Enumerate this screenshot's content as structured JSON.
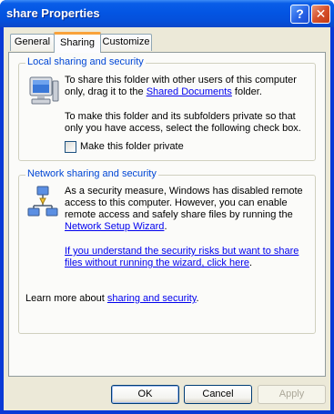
{
  "window": {
    "title": "share Properties",
    "help_glyph": "?",
    "close_glyph": "✕",
    "icons": {
      "help": "help-icon",
      "close": "close-icon"
    }
  },
  "tabs": [
    {
      "label": "General",
      "selected": false
    },
    {
      "label": "Sharing",
      "selected": true
    },
    {
      "label": "Customize",
      "selected": false
    }
  ],
  "local": {
    "legend": "Local sharing and security",
    "icon": "computer-icon",
    "para1_line1": "To share this folder with other users of this computer",
    "para1_line2_pre": "only, drag it to the ",
    "para1_link": "Shared Documents",
    "para1_line2_post": " folder.",
    "para2_line1": "To make this folder and its subfolders private so that",
    "para2_line2": "only you have access, select the following check box.",
    "checkbox_label": "Make this folder private",
    "checkbox_checked": false
  },
  "network": {
    "legend": "Network sharing and security",
    "icon": "network-share-icon",
    "line1": "As a security measure, Windows has disabled remote",
    "line2": "access to this computer. However, you can enable",
    "line3": "remote access and safely share files by running the",
    "wizard_link": "Network Setup Wizard",
    "wizard_period": ".",
    "risk_link_line1": "If you understand the security risks but want to share",
    "risk_link_line2": "files without running the wizard, click here",
    "risk_period": ".",
    "learn_pre": "Learn more about ",
    "learn_link": "sharing and security",
    "learn_post": "."
  },
  "buttons": {
    "ok": "OK",
    "cancel": "Cancel",
    "apply": "Apply",
    "apply_enabled": false
  },
  "colors": {
    "title_bar": "#0355e3",
    "legend": "#0046d5",
    "link": "#0000ee",
    "selected_tab_accent": "#f9a23a"
  }
}
